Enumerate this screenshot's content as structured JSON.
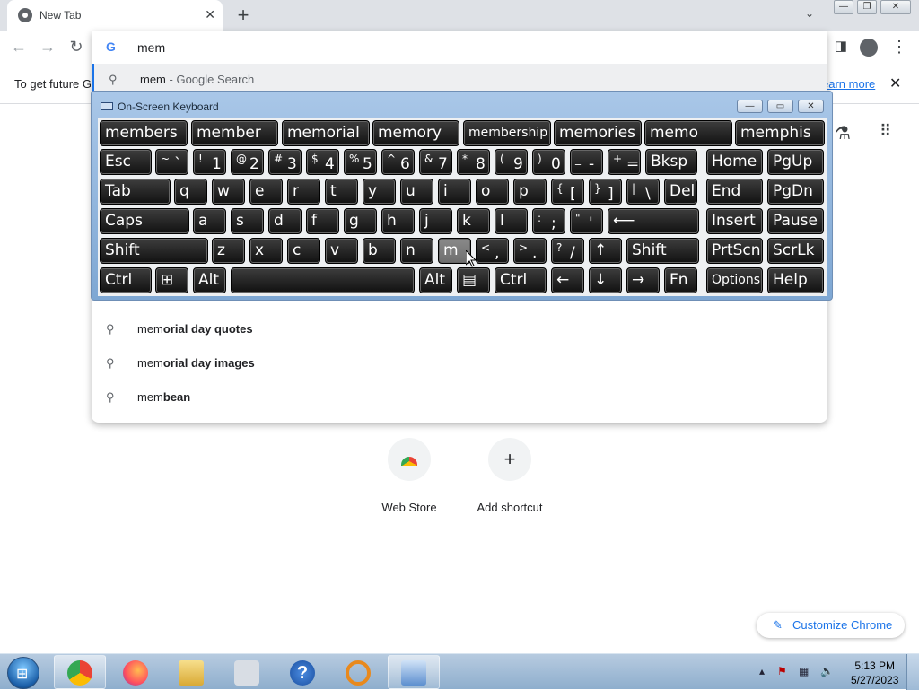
{
  "browser": {
    "tab_title": "New Tab",
    "tab_close": "✕",
    "new_tab": "+",
    "tab_search": "⌄",
    "address_query": "mem",
    "google_letter": "G",
    "top_suggestion": {
      "term": "mem",
      "suffix": "- Google Search"
    },
    "infobar_text": "To get future G",
    "infobar_link": "earn more",
    "suggestions": [
      {
        "prefix": "mem",
        "rest": "orial day quotes"
      },
      {
        "prefix": "mem",
        "rest": "orial day images"
      },
      {
        "prefix": "mem",
        "rest": "bean"
      }
    ]
  },
  "ntp": {
    "shortcuts": [
      {
        "label": "Web Store"
      },
      {
        "label": "Add shortcut",
        "icon": "+"
      }
    ],
    "customize": "Customize Chrome"
  },
  "osk": {
    "title": "On-Screen Keyboard",
    "predictions": [
      "members",
      "member",
      "memorial",
      "memory",
      "membership",
      "memories",
      "memo",
      "memphis"
    ],
    "rows": [
      [
        {
          "main": "Esc"
        },
        {
          "shift": "~",
          "main": "`"
        },
        {
          "shift": "!",
          "main": "1"
        },
        {
          "shift": "@",
          "main": "2"
        },
        {
          "shift": "#",
          "main": "3"
        },
        {
          "shift": "$",
          "main": "4"
        },
        {
          "shift": "%",
          "main": "5"
        },
        {
          "shift": "^",
          "main": "6"
        },
        {
          "shift": "&",
          "main": "7"
        },
        {
          "shift": "*",
          "main": "8"
        },
        {
          "shift": "(",
          "main": "9"
        },
        {
          "shift": ")",
          "main": "0"
        },
        {
          "shift": "_",
          "main": "-"
        },
        {
          "shift": "+",
          "main": "="
        },
        {
          "main": "Bksp"
        },
        {
          "main": "Home"
        },
        {
          "main": "PgUp"
        }
      ],
      [
        {
          "main": "Tab"
        },
        {
          "main": "q"
        },
        {
          "main": "w"
        },
        {
          "main": "e"
        },
        {
          "main": "r"
        },
        {
          "main": "t"
        },
        {
          "main": "y"
        },
        {
          "main": "u"
        },
        {
          "main": "i"
        },
        {
          "main": "o"
        },
        {
          "main": "p"
        },
        {
          "shift": "{",
          "main": "["
        },
        {
          "shift": "}",
          "main": "]"
        },
        {
          "shift": "|",
          "main": "\\"
        },
        {
          "main": "Del"
        },
        {
          "main": "End"
        },
        {
          "main": "PgDn"
        }
      ],
      [
        {
          "main": "Caps"
        },
        {
          "main": "a"
        },
        {
          "main": "s"
        },
        {
          "main": "d"
        },
        {
          "main": "f"
        },
        {
          "main": "g"
        },
        {
          "main": "h"
        },
        {
          "main": "j"
        },
        {
          "main": "k"
        },
        {
          "main": "l"
        },
        {
          "shift": ":",
          "main": ";"
        },
        {
          "shift": "\"",
          "main": "'"
        },
        {
          "main": "⟵"
        },
        {
          "main": "Insert"
        },
        {
          "main": "Pause"
        }
      ],
      [
        {
          "main": "Shift"
        },
        {
          "main": "z"
        },
        {
          "main": "x"
        },
        {
          "main": "c"
        },
        {
          "main": "v"
        },
        {
          "main": "b"
        },
        {
          "main": "n"
        },
        {
          "main": "m"
        },
        {
          "shift": "<",
          "main": ","
        },
        {
          "shift": ">",
          "main": "."
        },
        {
          "shift": "?",
          "main": "/"
        },
        {
          "main": "↑"
        },
        {
          "main": "Shift"
        },
        {
          "main": "PrtScn"
        },
        {
          "main": "ScrLk"
        }
      ],
      [
        {
          "main": "Ctrl"
        },
        {
          "main": "⊞"
        },
        {
          "main": "Alt"
        },
        {
          "main": ""
        },
        {
          "main": "Alt"
        },
        {
          "main": "▤"
        },
        {
          "main": "Ctrl"
        },
        {
          "main": "←"
        },
        {
          "main": "↓"
        },
        {
          "main": "→"
        },
        {
          "main": "Fn"
        },
        {
          "main": "Options"
        },
        {
          "main": "Help"
        }
      ]
    ]
  },
  "taskbar": {
    "time": "5:13 PM",
    "date": "5/27/2023"
  }
}
